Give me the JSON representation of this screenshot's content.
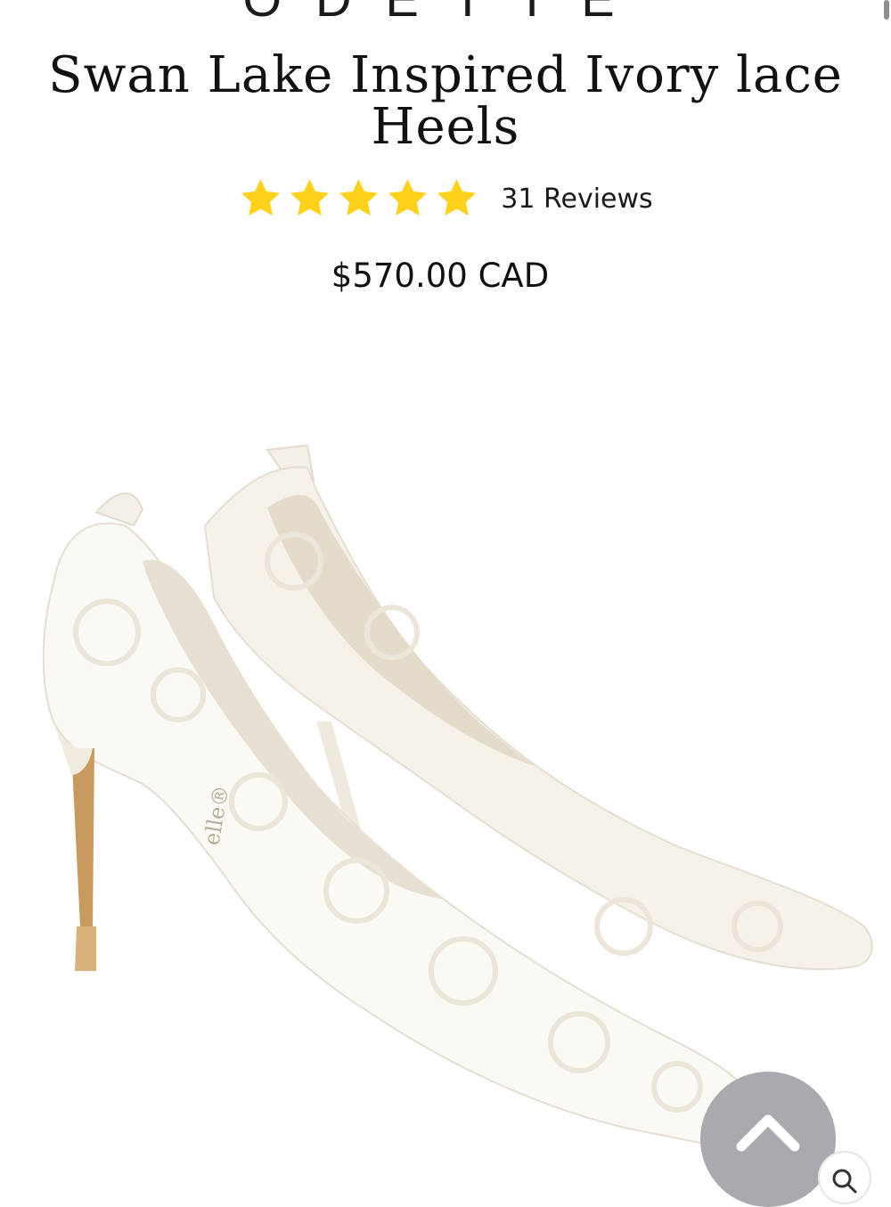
{
  "brand": {
    "name": "ODETTE"
  },
  "product": {
    "title": "Swan Lake Inspired Ivory lace Heels",
    "rating": {
      "stars": 5,
      "max_stars": 5,
      "reviews_label": "31 Reviews"
    },
    "price": "$570.00 CAD",
    "image_alt": "Ivory lace pointed-toe heels",
    "shoe_label": "elle®"
  },
  "controls": {
    "scroll_top_icon": "chevron-up-icon",
    "corner_icon": "search-icon"
  },
  "colors": {
    "star": "#FFD11A",
    "scroll_button": "#A8AAAE",
    "lace": "#FBF9F4",
    "lining": "#E7DFD1",
    "heel": "#C79A5E"
  }
}
